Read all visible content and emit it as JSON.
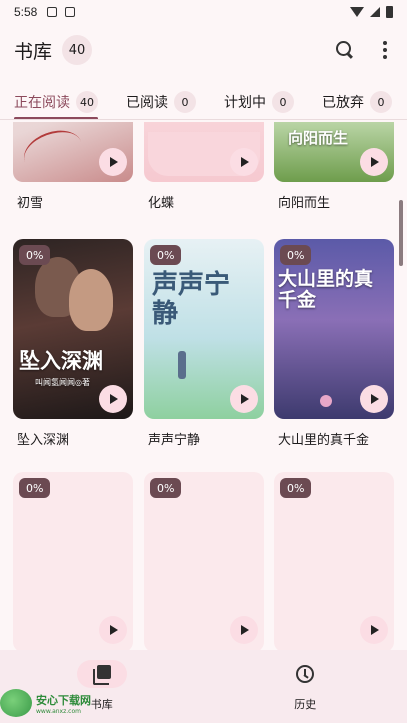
{
  "status": {
    "time": "5:58"
  },
  "app_bar": {
    "title": "书库",
    "count": "40"
  },
  "tabs": [
    {
      "label": "正在阅读",
      "count": "40"
    },
    {
      "label": "已阅读",
      "count": "0"
    },
    {
      "label": "计划中",
      "count": "0"
    },
    {
      "label": "已放弃",
      "count": "0"
    }
  ],
  "books": [
    {
      "title": "初雪",
      "progress": "",
      "cover_text": ""
    },
    {
      "title": "化蝶",
      "progress": "",
      "cover_text": ""
    },
    {
      "title": "向阳而生",
      "progress": "",
      "cover_text": "向阳而生"
    },
    {
      "title": "坠入深渊",
      "progress": "0%",
      "cover_text": "坠入深渊",
      "cover_sub": "叫闻氢闻闻◎著"
    },
    {
      "title": "声声宁静",
      "progress": "0%",
      "cover_text": "声声宁静"
    },
    {
      "title": "大山里的真千金",
      "progress": "0%",
      "cover_text": "大山里的真千金"
    },
    {
      "title": "",
      "progress": "0%",
      "cover_text": ""
    },
    {
      "title": "",
      "progress": "0%",
      "cover_text": ""
    },
    {
      "title": "",
      "progress": "0%",
      "cover_text": ""
    }
  ],
  "bottom_nav": [
    {
      "label": "书库",
      "icon": "library-icon",
      "active": true
    },
    {
      "label": "历史",
      "icon": "clock-icon",
      "active": false
    }
  ],
  "watermark": {
    "title": "安心下载网",
    "url": "www.anxz.com"
  },
  "colors": {
    "accent": "#8c4a5c",
    "background": "#fdf6f7",
    "pill": "#f3e3e6",
    "play": "#fbdde4"
  }
}
